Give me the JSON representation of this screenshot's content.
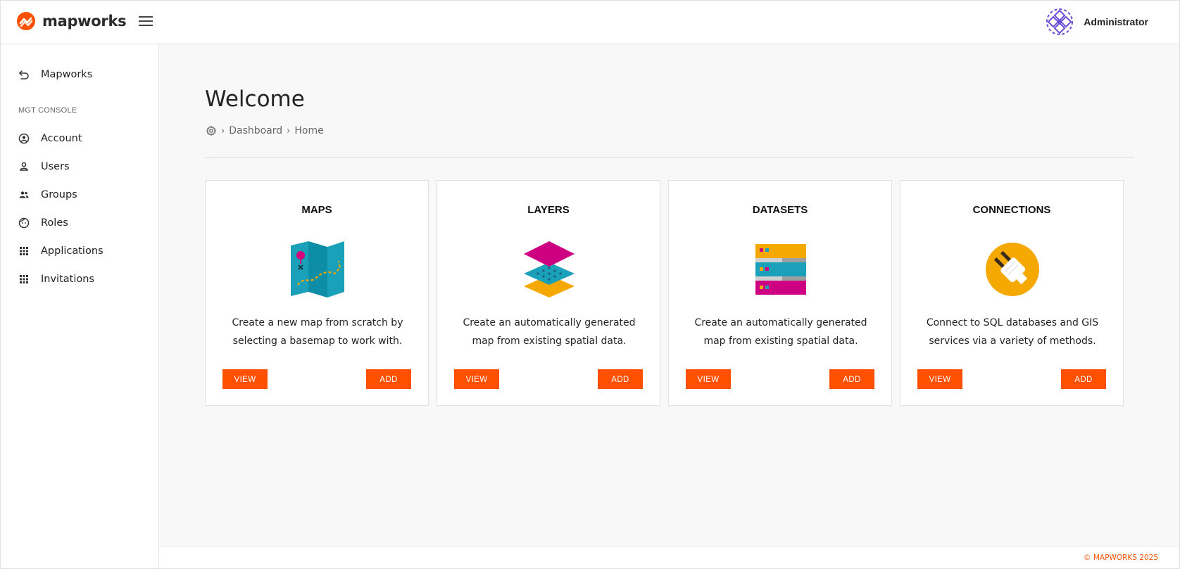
{
  "header": {
    "brand": "mapworks",
    "user_name": "Administrator",
    "brand_color": "#ff5000"
  },
  "sidebar": {
    "back_item": {
      "label": "Mapworks",
      "icon": "back-arrow-icon"
    },
    "section_label": "MGT CONSOLE",
    "items": [
      {
        "label": "Account",
        "icon": "account-circle-icon"
      },
      {
        "label": "Users",
        "icon": "user-icon"
      },
      {
        "label": "Groups",
        "icon": "group-icon"
      },
      {
        "label": "Roles",
        "icon": "role-face-icon"
      },
      {
        "label": "Applications",
        "icon": "grid-icon"
      },
      {
        "label": "Invitations",
        "icon": "grid-icon"
      }
    ]
  },
  "main": {
    "title": "Welcome",
    "breadcrumb": [
      "Dashboard",
      "Home"
    ],
    "cards": [
      {
        "title": "MAPS",
        "description": "Create a new map from scratch by selecting a basemap to work with.",
        "view_label": "VIEW",
        "add_label": "ADD",
        "icon": "folded-map-icon"
      },
      {
        "title": "LAYERS",
        "description": "Create an automatically generated map from existing spatial data.",
        "view_label": "VIEW",
        "add_label": "ADD",
        "icon": "stacked-layers-icon"
      },
      {
        "title": "DATASETS",
        "description": "Create an automatically generated map from existing spatial data.",
        "view_label": "VIEW",
        "add_label": "ADD",
        "icon": "database-stack-icon"
      },
      {
        "title": "CONNECTIONS",
        "description": "Connect to SQL databases and GIS services via a variety of methods.",
        "view_label": "VIEW",
        "add_label": "ADD",
        "icon": "plug-icon"
      }
    ]
  },
  "footer": {
    "copyright": "© MAPWORKS 2025"
  }
}
